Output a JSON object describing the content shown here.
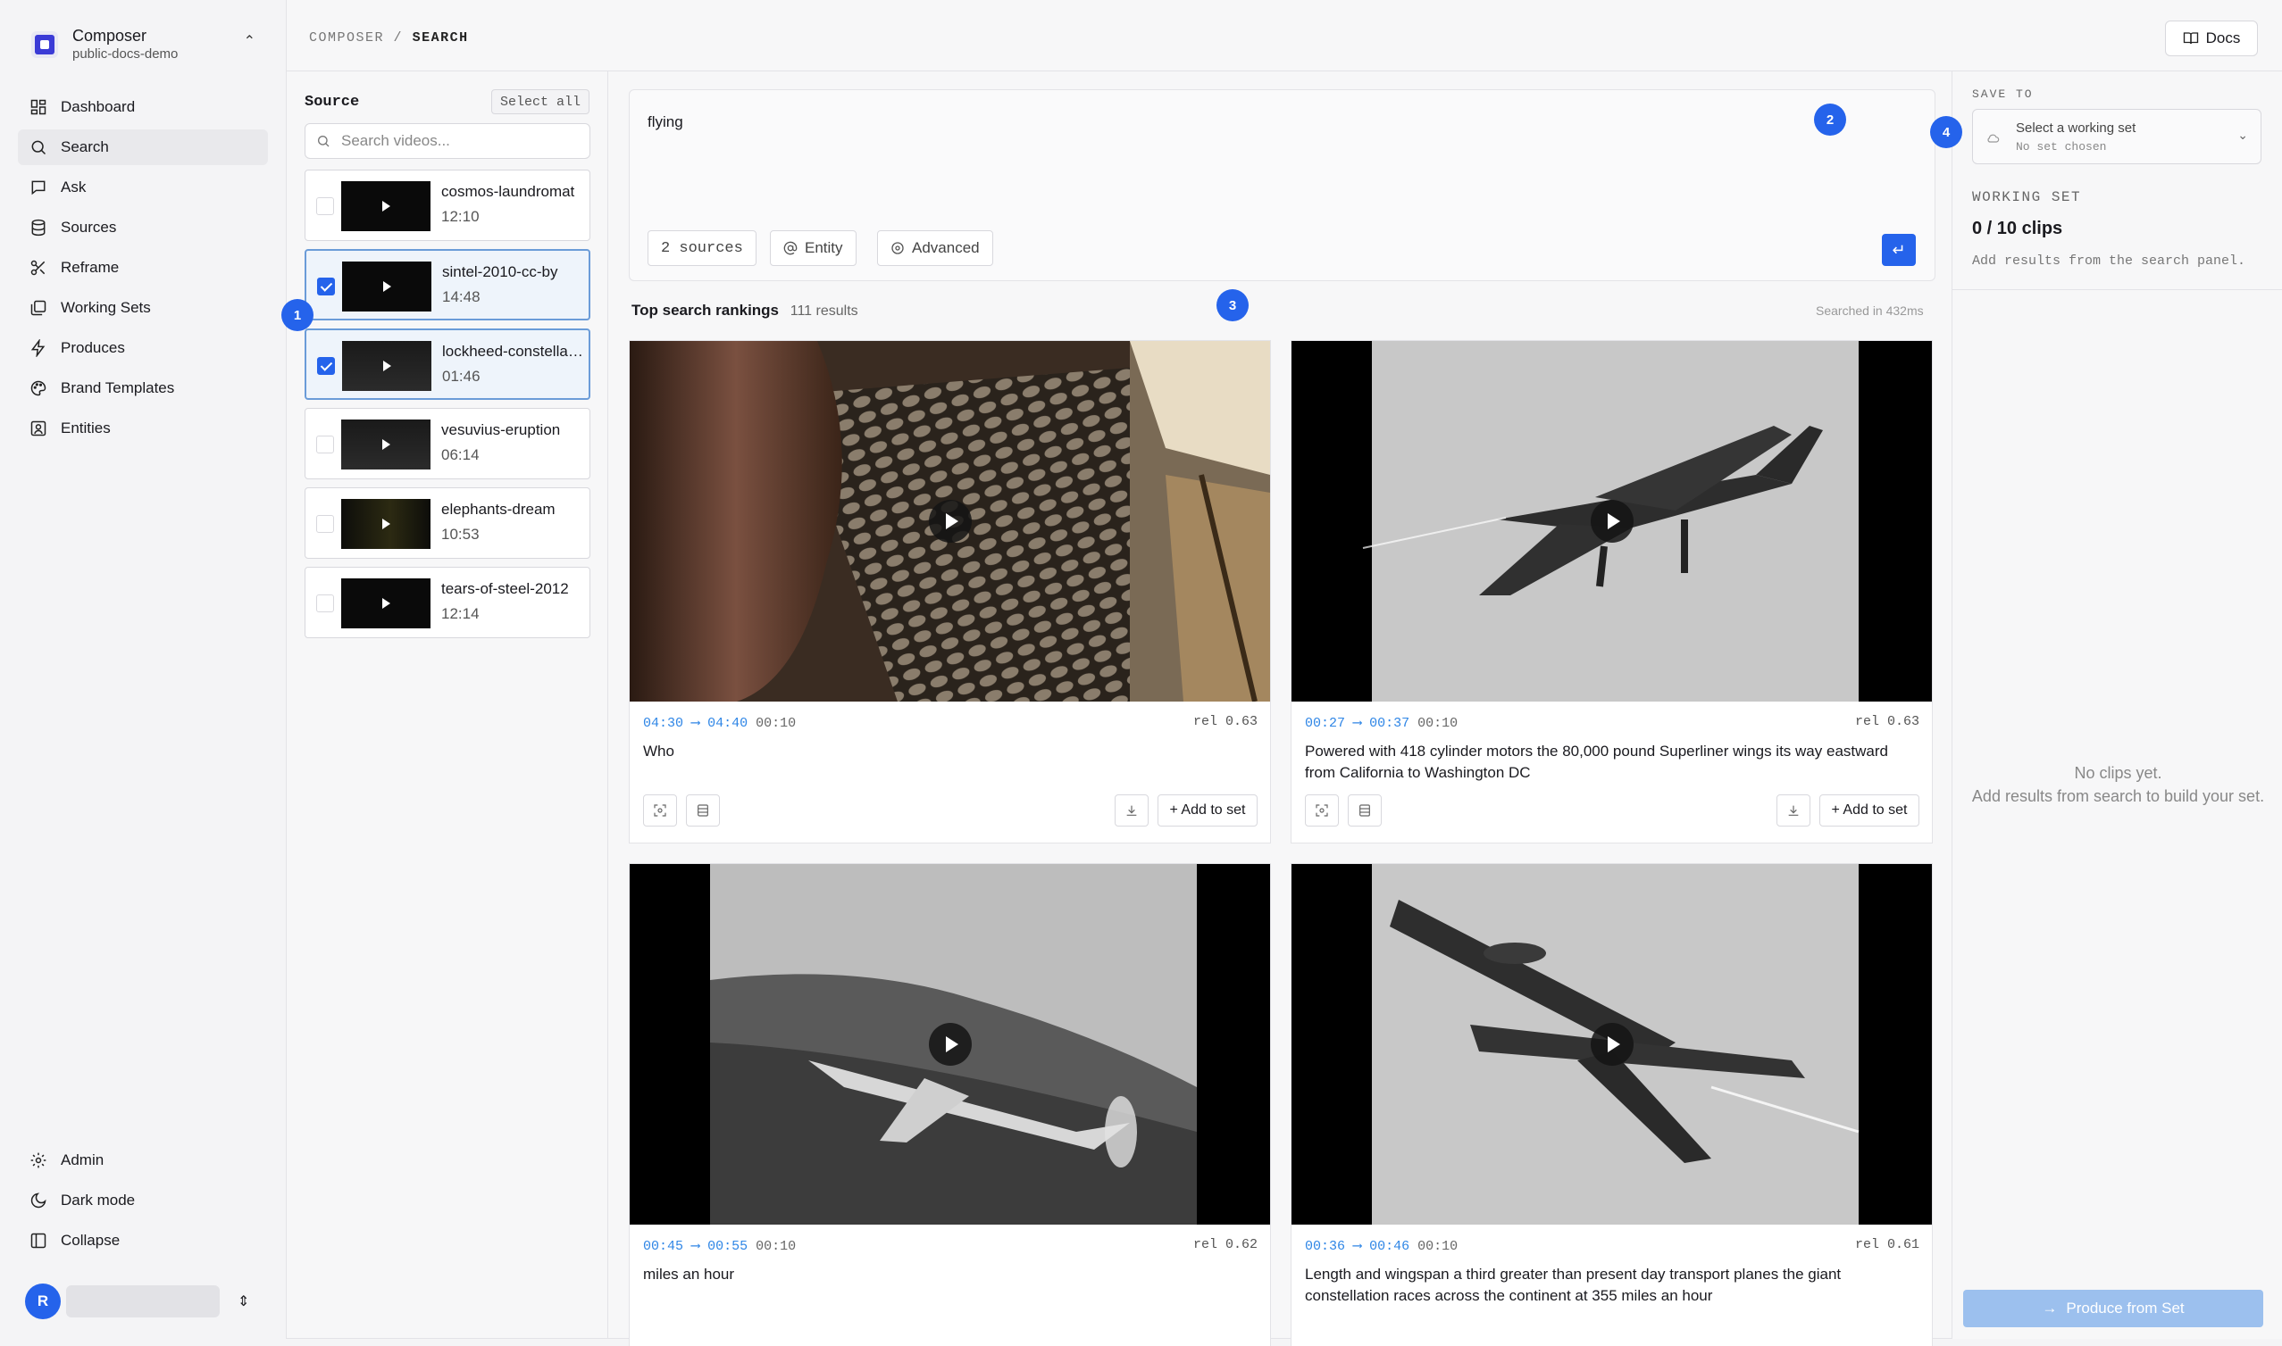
{
  "workspace": {
    "name": "Composer",
    "subtitle": "public-docs-demo"
  },
  "nav": [
    {
      "label": "Dashboard",
      "icon": "grid-icon",
      "active": false
    },
    {
      "label": "Search",
      "icon": "search-icon",
      "active": true
    },
    {
      "label": "Ask",
      "icon": "chat-icon",
      "active": false
    },
    {
      "label": "Sources",
      "icon": "database-icon",
      "active": false
    },
    {
      "label": "Reframe",
      "icon": "scissors-icon",
      "active": false
    },
    {
      "label": "Working Sets",
      "icon": "layers-icon",
      "active": false
    },
    {
      "label": "Produces",
      "icon": "bolt-icon",
      "active": false
    },
    {
      "label": "Brand Templates",
      "icon": "palette-icon",
      "active": false
    },
    {
      "label": "Entities",
      "icon": "person-card-icon",
      "active": false
    }
  ],
  "nav_bottom": [
    {
      "label": "Admin",
      "icon": "gear-icon"
    },
    {
      "label": "Dark mode",
      "icon": "moon-icon"
    },
    {
      "label": "Collapse",
      "icon": "sidebar-collapse-icon"
    }
  ],
  "user": {
    "initial": "R"
  },
  "breadcrumb": {
    "parent": "COMPOSER",
    "separator": "/",
    "current": "SEARCH"
  },
  "docs_label": "Docs",
  "source": {
    "title": "Source",
    "select_all": "Select all",
    "search_placeholder": "Search videos...",
    "videos": [
      {
        "name": "cosmos-laundromat",
        "duration": "12:10",
        "selected": false
      },
      {
        "name": "sintel-2010-cc-by",
        "duration": "14:48",
        "selected": true
      },
      {
        "name": "lockheed-constellation",
        "duration": "01:46",
        "selected": true
      },
      {
        "name": "vesuvius-eruption",
        "duration": "06:14",
        "selected": false
      },
      {
        "name": "elephants-dream",
        "duration": "10:53",
        "selected": false
      },
      {
        "name": "tears-of-steel-2012",
        "duration": "12:14",
        "selected": false
      }
    ]
  },
  "query": {
    "text": "flying",
    "sources_chip": "2 sources",
    "entity_chip": "Entity",
    "advanced_chip": "Advanced",
    "submit_icon": "enter-icon"
  },
  "results": {
    "title": "Top search rankings",
    "count": "111 results",
    "timing": "Searched in 432ms",
    "arrow": "⟶",
    "add_label": "+ Add to set",
    "items": [
      {
        "start": "04:30",
        "end": "04:40",
        "length": "00:10",
        "rel": "rel 0.63",
        "caption": "Who"
      },
      {
        "start": "00:27",
        "end": "00:37",
        "length": "00:10",
        "rel": "rel 0.63",
        "caption": "Powered with 418 cylinder motors the 80,000 pound Superliner wings its way eastward from California to Washington DC"
      },
      {
        "start": "00:45",
        "end": "00:55",
        "length": "00:10",
        "rel": "rel 0.62",
        "caption": "miles an hour"
      },
      {
        "start": "00:36",
        "end": "00:46",
        "length": "00:10",
        "rel": "rel 0.61",
        "caption": "Length and wingspan a third greater than present day transport planes the giant constellation races across the continent at 355 miles an hour"
      }
    ]
  },
  "right": {
    "save_to": "SAVE TO",
    "select_title": "Select a working set",
    "select_sub": "No set chosen",
    "ws_label": "WORKING SET",
    "ws_count": "0 / 10 clips",
    "ws_hint": "Add results from the search panel.",
    "empty_1": "No clips yet.",
    "empty_2": "Add results from search to build your set.",
    "produce": "Produce from Set"
  },
  "callouts": [
    "1",
    "2",
    "3",
    "4"
  ],
  "colors": {
    "accent": "#2563eb",
    "time": "#2f86e6",
    "produce_disabled": "#9cc0ee"
  }
}
